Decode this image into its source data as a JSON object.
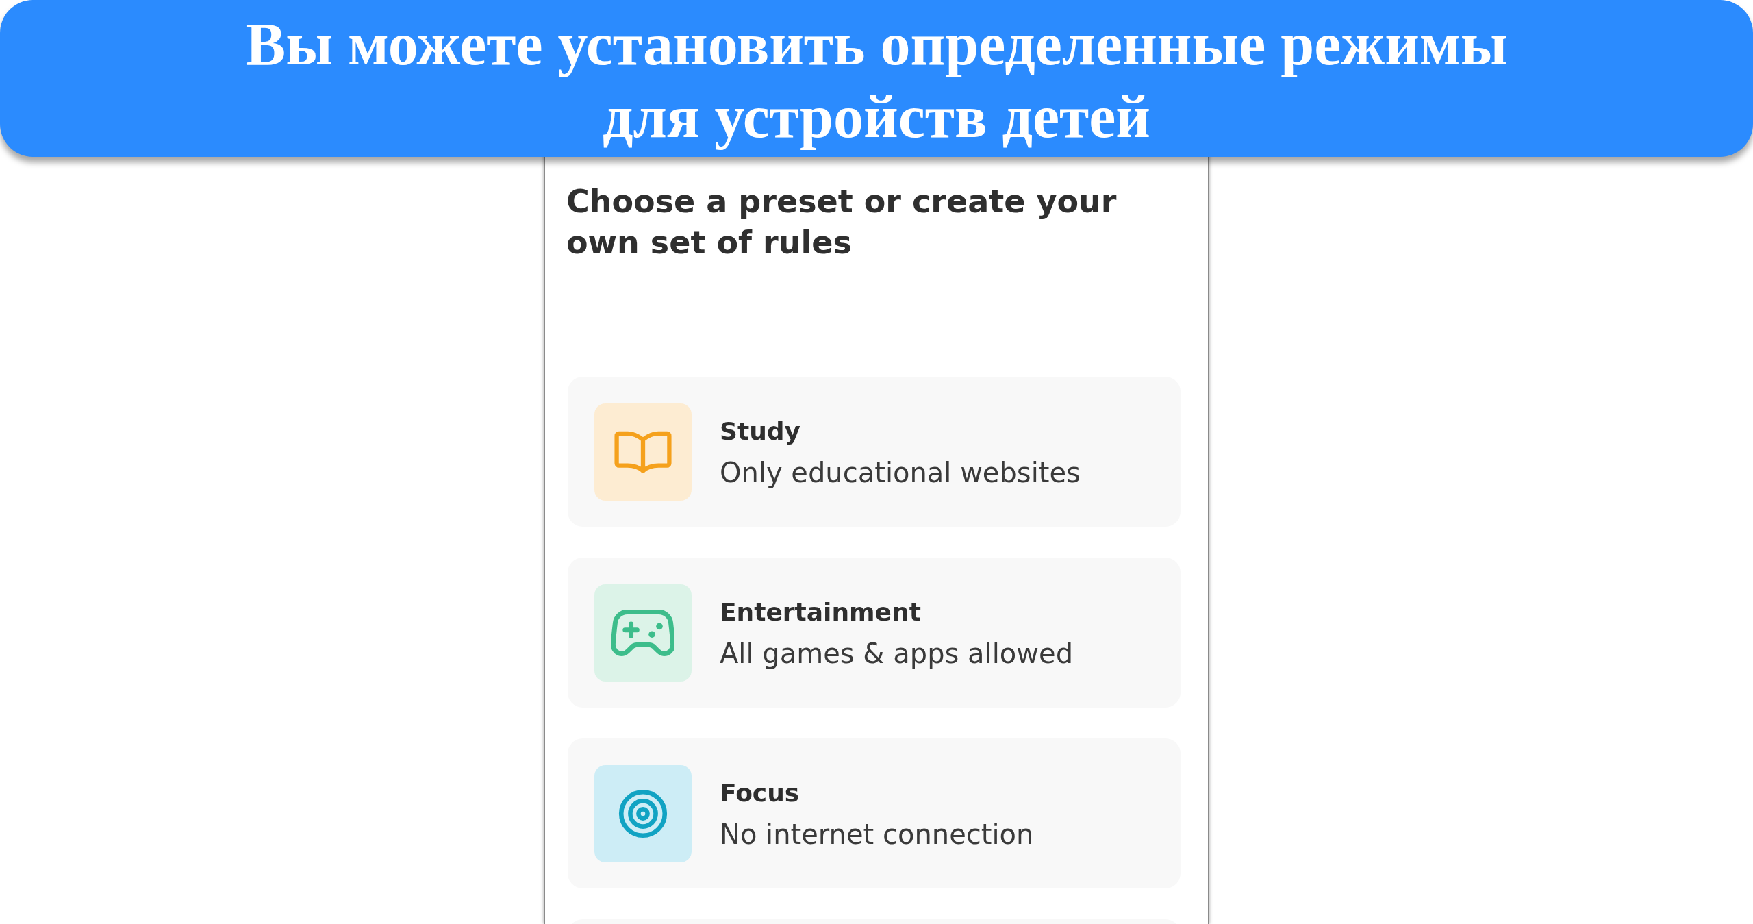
{
  "banner": {
    "title": "Вы можете установить определенные режимы для устройств детей"
  },
  "screen": {
    "heading": "Choose a preset or create your own set of rules",
    "presets": [
      {
        "kind": "study",
        "title": "Study",
        "description": "Only educational websites"
      },
      {
        "kind": "entertainment",
        "title": "Entertainment",
        "description": "All games & apps allowed"
      },
      {
        "kind": "focus",
        "title": "Focus",
        "description": "No internet connection"
      }
    ]
  }
}
